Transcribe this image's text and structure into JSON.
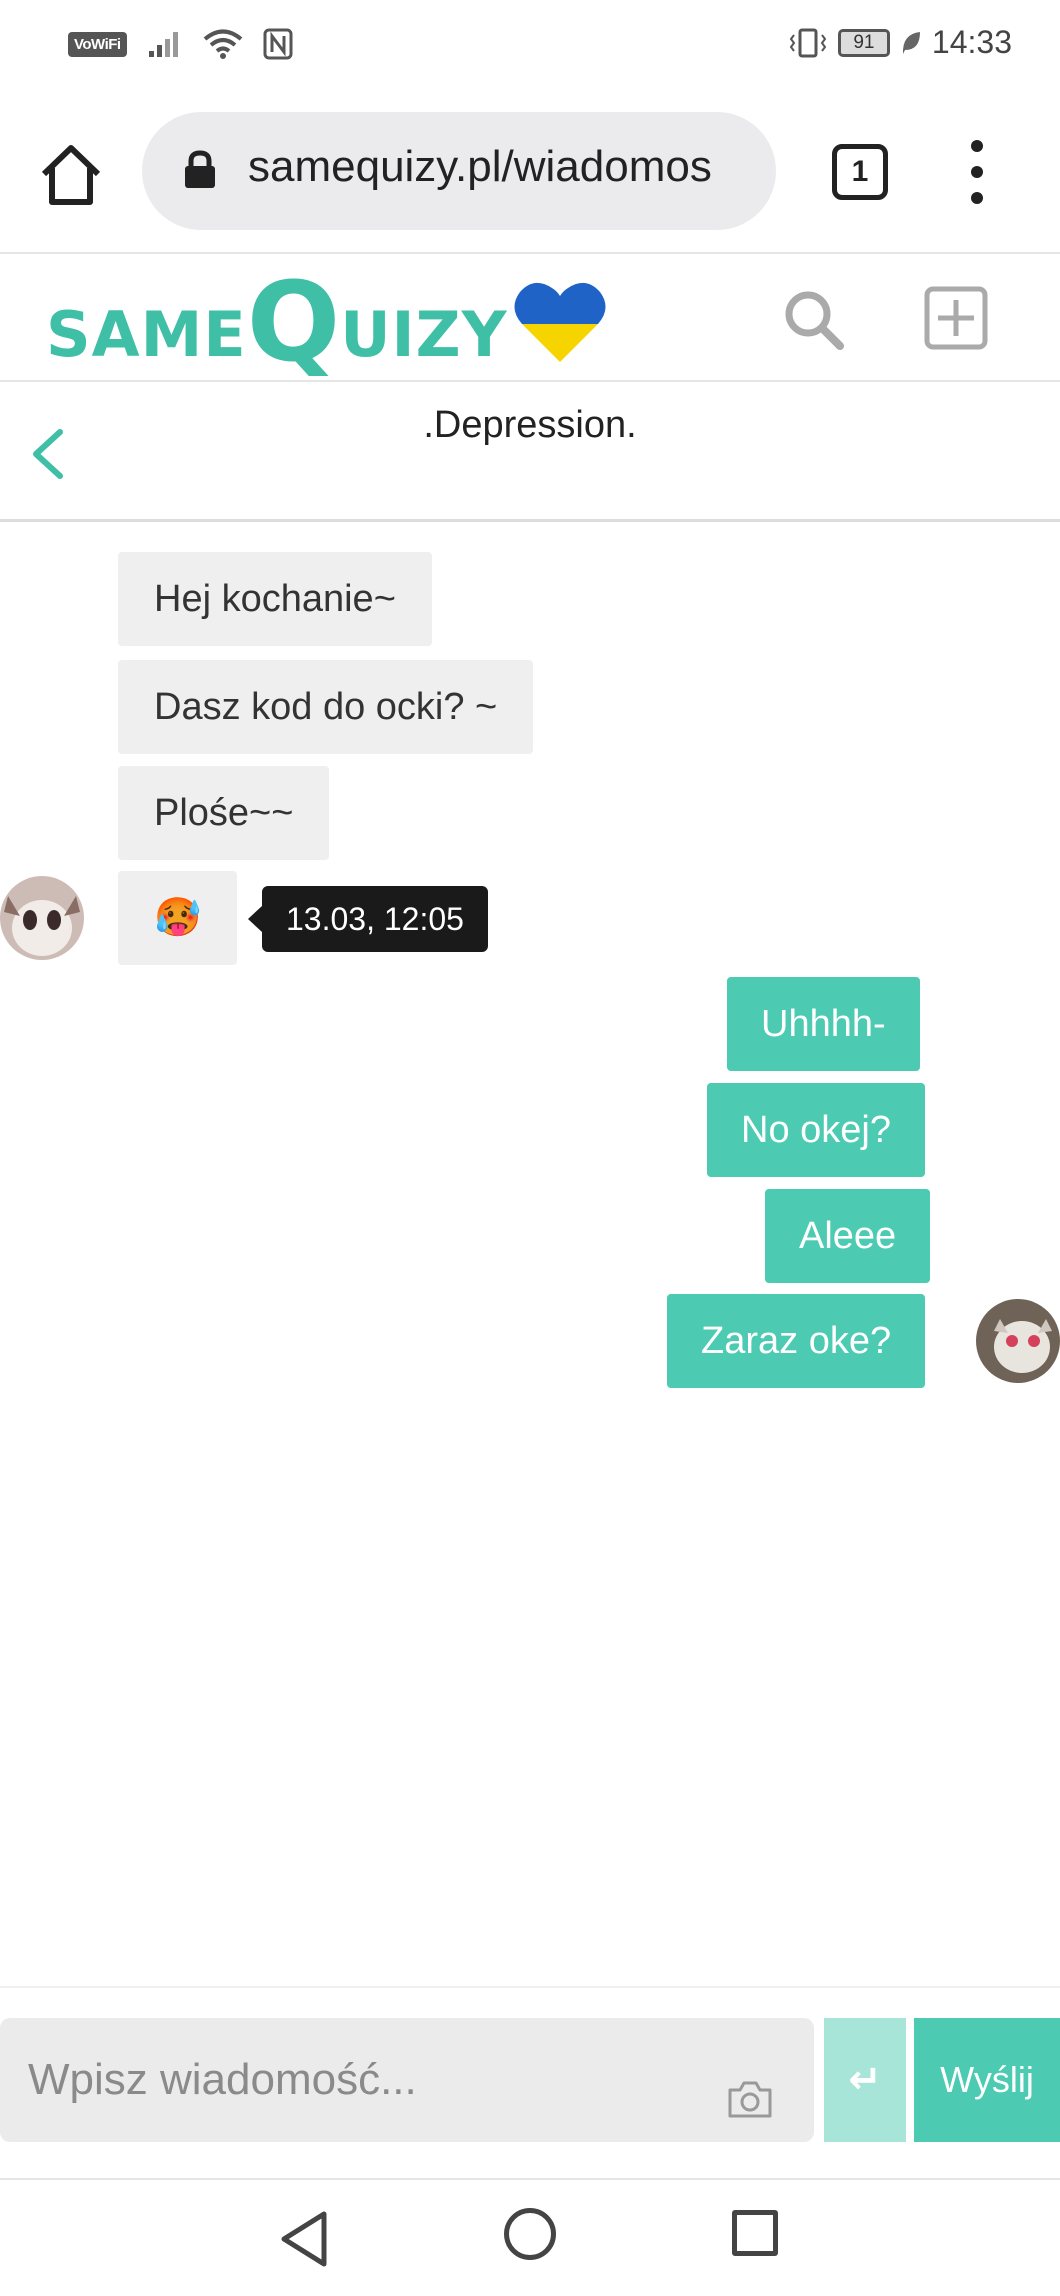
{
  "status_bar": {
    "vowifi": "VoWiFi",
    "battery": "91",
    "time": "14:33"
  },
  "browser": {
    "url": "samequizy.pl/wiadomos",
    "tab_count": "1"
  },
  "site": {
    "logo_same": "SAME",
    "logo_q": "Q",
    "logo_uizy": "UIZY",
    "accent_color": "#4ccab2",
    "heart_colors": [
      "#1f63c6",
      "#f6d400"
    ]
  },
  "conversation": {
    "title": ".Depression.",
    "incoming": [
      {
        "text": "Hej kochanie~"
      },
      {
        "text": "Dasz kod do ocki? ~"
      },
      {
        "text": "Plośe~~"
      },
      {
        "text": "🥵"
      }
    ],
    "tooltip": "13.03, 12:05",
    "outgoing": [
      {
        "text": "Uhhhh-"
      },
      {
        "text": "No okej?"
      },
      {
        "text": "Aleee"
      },
      {
        "text": "Zaraz oke?"
      }
    ]
  },
  "composer": {
    "placeholder": "Wpisz wiadomość...",
    "enter_symbol": "↵",
    "send_label": "Wyślij"
  }
}
